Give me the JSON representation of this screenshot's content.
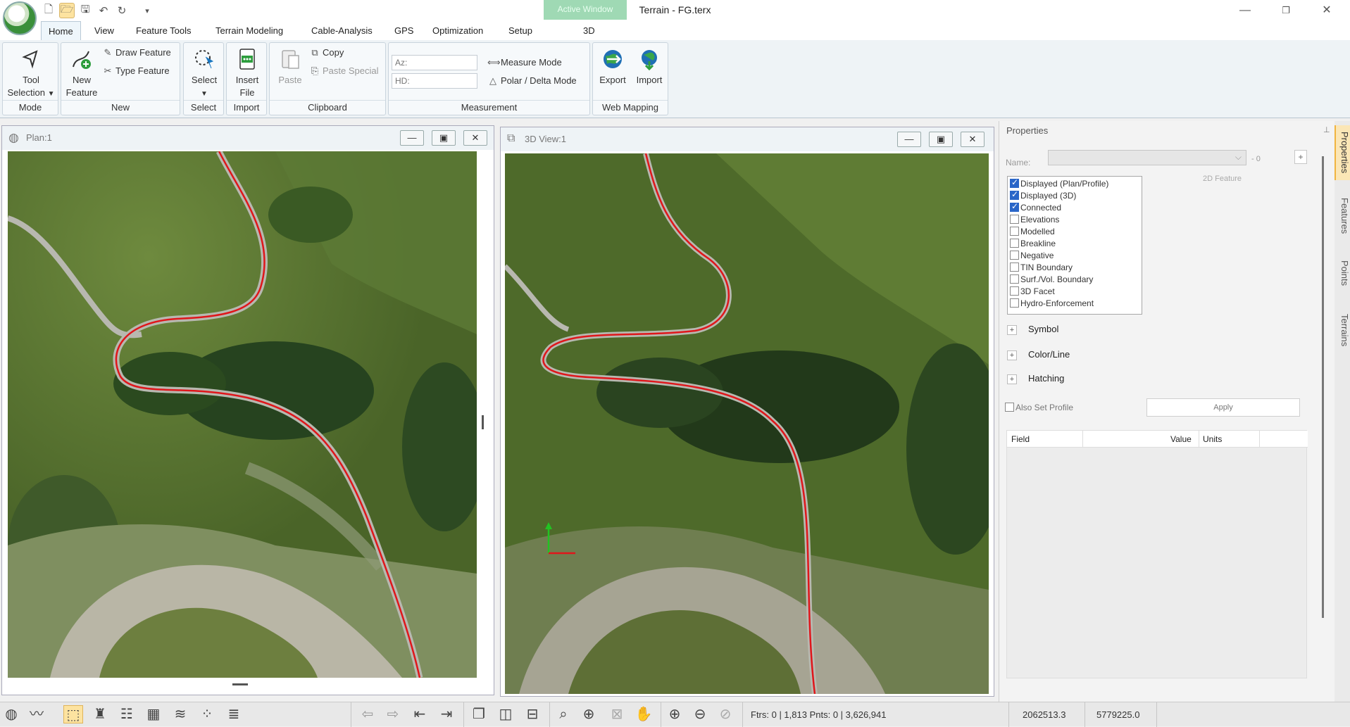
{
  "window": {
    "title": "Terrain - FG.terx",
    "active_window_label": "Active Window"
  },
  "qat": [
    "new-file-icon",
    "open-folder-icon",
    "save-icon",
    "undo-icon",
    "redo-icon",
    "qat-menu-icon"
  ],
  "tabs": [
    {
      "label": "Home",
      "active": true
    },
    {
      "label": "View"
    },
    {
      "label": "Feature Tools"
    },
    {
      "label": "Terrain Modeling"
    },
    {
      "label": "Cable-Analysis"
    },
    {
      "label": "GPS"
    },
    {
      "label": "Optimization"
    },
    {
      "label": "Setup"
    },
    {
      "label": "3D"
    }
  ],
  "ribbon": {
    "mode": {
      "label": "Mode",
      "tool_line1": "Tool",
      "tool_line2": "Selection"
    },
    "new": {
      "label": "New",
      "new_line1": "New",
      "new_line2": "Feature",
      "draw": "Draw Feature",
      "type": "Type Feature"
    },
    "select": {
      "label": "Select",
      "btn": "Select"
    },
    "import": {
      "label": "Import",
      "line1": "Insert",
      "line2": "File"
    },
    "clipboard": {
      "label": "Clipboard",
      "paste": "Paste",
      "copy": "Copy",
      "paste_special": "Paste Special"
    },
    "measurement": {
      "label": "Measurement",
      "az_placeholder": "Az:",
      "hd_placeholder": "HD:",
      "measure_mode": "Measure Mode",
      "polar_mode": "Polar / Delta Mode"
    },
    "web_mapping": {
      "label": "Web Mapping",
      "export": "Export",
      "import": "Import"
    }
  },
  "plan_view": {
    "title": "Plan:1"
  },
  "view_3d": {
    "title": "3D View:1"
  },
  "properties": {
    "title": "Properties",
    "name_label": "Name:",
    "name_suffix": "- 0",
    "feature_type": "2D Feature",
    "checkboxes": [
      {
        "label": "Displayed (Plan/Profile)",
        "checked": true
      },
      {
        "label": "Displayed (3D)",
        "checked": true
      },
      {
        "label": "Connected",
        "checked": true
      },
      {
        "label": "Elevations",
        "checked": false
      },
      {
        "label": "Modelled",
        "checked": false
      },
      {
        "label": "Breakline",
        "checked": false
      },
      {
        "label": "Negative",
        "checked": false
      },
      {
        "label": "TIN Boundary",
        "checked": false
      },
      {
        "label": "Surf./Vol. Boundary",
        "checked": false
      },
      {
        "label": "3D Facet",
        "checked": false
      },
      {
        "label": "Hydro-Enforcement",
        "checked": false
      }
    ],
    "sections": [
      "Symbol",
      "Color/Line",
      "Hatching"
    ],
    "also_set_profile": "Also Set Profile",
    "apply": "Apply",
    "table_headers": [
      "Field",
      "Value",
      "Units"
    ]
  },
  "side_tabs": [
    "Properties",
    "Features",
    "Points",
    "Terrains"
  ],
  "status": {
    "counts": "Ftrs: 0 | 1,813  Pnts: 0 | 3,626,941",
    "easting": "2062513.3",
    "northing": "5779225.0"
  },
  "colors": {
    "accent": "#2a66c8",
    "road_line": "#e0161b",
    "active_window": "#9fd9b4"
  }
}
